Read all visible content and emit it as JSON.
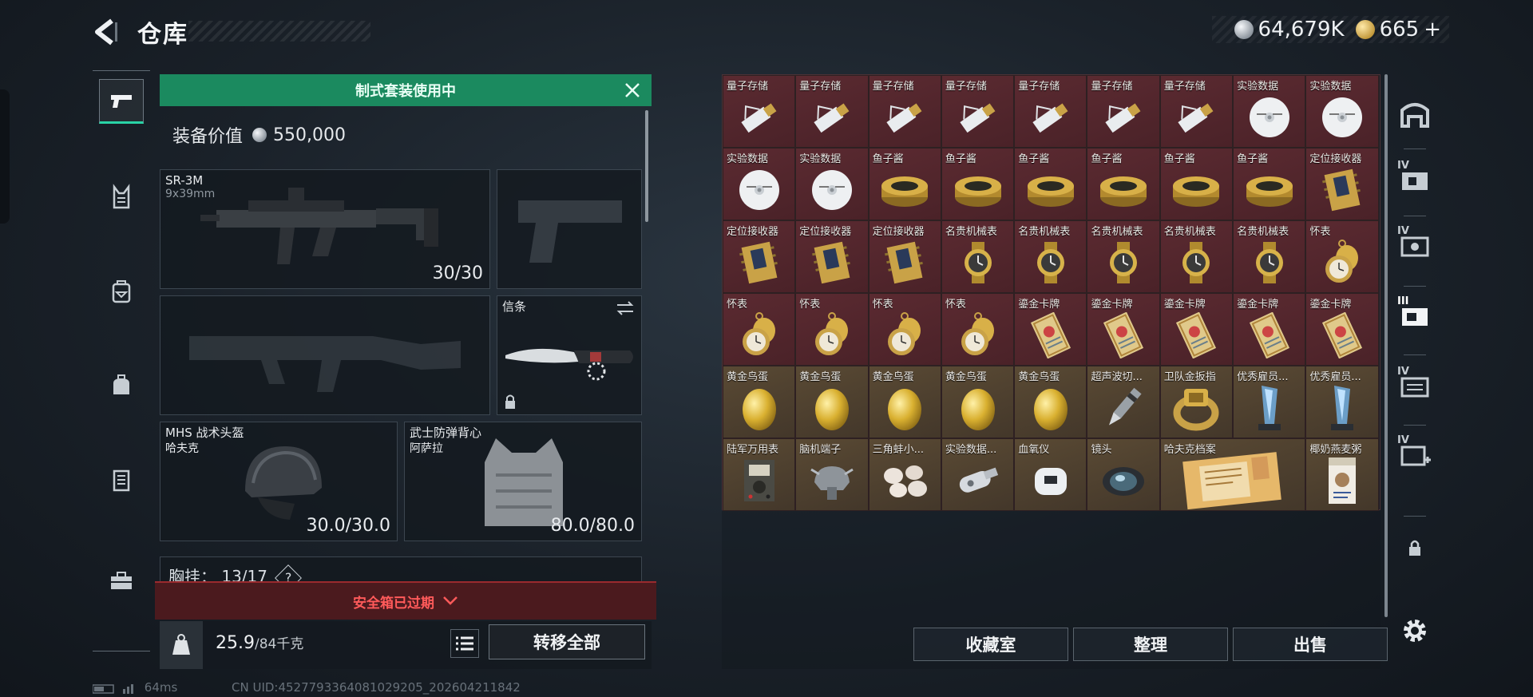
{
  "header": {
    "title": "仓库",
    "back_icon": "back-arrow-icon"
  },
  "currency": {
    "silver": "64,679K",
    "gold": "665",
    "gold_add": "+"
  },
  "tabs": [
    {
      "icon": "pistol-icon",
      "active": true
    },
    {
      "icon": "armor-icon"
    },
    {
      "icon": "backpack-icon"
    },
    {
      "icon": "bag-icon"
    },
    {
      "icon": "case-icon"
    },
    {
      "icon": "toolbox-icon"
    }
  ],
  "loadout": {
    "banner": "制式套装使用中",
    "value_label": "装备价值",
    "value": "550,000",
    "primary": {
      "name": "SR-3M",
      "caliber": "9x39mm",
      "ammo": "30/30"
    },
    "knife": {
      "name": "信条"
    },
    "helmet": {
      "name": "MHS 战术头盔",
      "sub": "哈夫克",
      "durability": "30.0/30.0"
    },
    "vest": {
      "name": "武士防弹背心",
      "sub": "阿萨拉",
      "durability": "80.0/80.0"
    },
    "chest_label": "胸挂：",
    "chest_value": "13/17",
    "chest_help": "?",
    "safe_expired": "安全箱已过期",
    "weight": "25.9",
    "weight_max": "/84千克",
    "transfer_all": "转移全部"
  },
  "storage": {
    "items": [
      {
        "label": "量子存储",
        "icon": "usb-drive-icon",
        "bg": "red"
      },
      {
        "label": "量子存储",
        "icon": "usb-drive-icon",
        "bg": "red"
      },
      {
        "label": "量子存储",
        "icon": "usb-drive-icon",
        "bg": "red"
      },
      {
        "label": "量子存储",
        "icon": "usb-drive-icon",
        "bg": "red"
      },
      {
        "label": "量子存储",
        "icon": "usb-drive-icon",
        "bg": "red"
      },
      {
        "label": "量子存储",
        "icon": "usb-drive-icon",
        "bg": "red"
      },
      {
        "label": "量子存储",
        "icon": "usb-drive-icon",
        "bg": "red"
      },
      {
        "label": "实验数据",
        "icon": "disc-icon",
        "bg": "red"
      },
      {
        "label": "实验数据",
        "icon": "disc-icon",
        "bg": "red"
      },
      {
        "label": "实验数据",
        "icon": "disc-icon",
        "bg": "red"
      },
      {
        "label": "实验数据",
        "icon": "disc-icon",
        "bg": "red"
      },
      {
        "label": "鱼子酱",
        "icon": "caviar-tin-icon",
        "bg": "red"
      },
      {
        "label": "鱼子酱",
        "icon": "caviar-tin-icon",
        "bg": "red"
      },
      {
        "label": "鱼子酱",
        "icon": "caviar-tin-icon",
        "bg": "red"
      },
      {
        "label": "鱼子酱",
        "icon": "caviar-tin-icon",
        "bg": "red"
      },
      {
        "label": "鱼子酱",
        "icon": "caviar-tin-icon",
        "bg": "red"
      },
      {
        "label": "鱼子酱",
        "icon": "caviar-tin-icon",
        "bg": "red"
      },
      {
        "label": "定位接收器",
        "icon": "gps-receiver-icon",
        "bg": "red"
      },
      {
        "label": "定位接收器",
        "icon": "gps-receiver-icon",
        "bg": "red"
      },
      {
        "label": "定位接收器",
        "icon": "gps-receiver-icon",
        "bg": "red"
      },
      {
        "label": "定位接收器",
        "icon": "gps-receiver-icon",
        "bg": "red"
      },
      {
        "label": "名贵机械表",
        "icon": "watch-icon",
        "bg": "red"
      },
      {
        "label": "名贵机械表",
        "icon": "watch-icon",
        "bg": "red"
      },
      {
        "label": "名贵机械表",
        "icon": "watch-icon",
        "bg": "red"
      },
      {
        "label": "名贵机械表",
        "icon": "watch-icon",
        "bg": "red"
      },
      {
        "label": "名贵机械表",
        "icon": "watch-icon",
        "bg": "red"
      },
      {
        "label": "怀表",
        "icon": "pocket-watch-icon",
        "bg": "red"
      },
      {
        "label": "怀表",
        "icon": "pocket-watch-icon",
        "bg": "red"
      },
      {
        "label": "怀表",
        "icon": "pocket-watch-icon",
        "bg": "red"
      },
      {
        "label": "怀表",
        "icon": "pocket-watch-icon",
        "bg": "red"
      },
      {
        "label": "怀表",
        "icon": "pocket-watch-icon",
        "bg": "red"
      },
      {
        "label": "鎏金卡牌",
        "icon": "gold-card-icon",
        "bg": "red"
      },
      {
        "label": "鎏金卡牌",
        "icon": "gold-card-icon",
        "bg": "red"
      },
      {
        "label": "鎏金卡牌",
        "icon": "gold-card-icon",
        "bg": "red"
      },
      {
        "label": "鎏金卡牌",
        "icon": "gold-card-icon",
        "bg": "red"
      },
      {
        "label": "鎏金卡牌",
        "icon": "gold-card-icon",
        "bg": "red"
      },
      {
        "label": "黄金鸟蛋",
        "icon": "golden-egg-icon",
        "bg": "gold"
      },
      {
        "label": "黄金鸟蛋",
        "icon": "golden-egg-icon",
        "bg": "gold"
      },
      {
        "label": "黄金鸟蛋",
        "icon": "golden-egg-icon",
        "bg": "gold"
      },
      {
        "label": "黄金鸟蛋",
        "icon": "golden-egg-icon",
        "bg": "gold"
      },
      {
        "label": "黄金鸟蛋",
        "icon": "golden-egg-icon",
        "bg": "gold"
      },
      {
        "label": "超声波切...",
        "icon": "ultrasonic-cutter-icon",
        "bg": "gold"
      },
      {
        "label": "卫队金扳指",
        "icon": "gold-ring-icon",
        "bg": "gold"
      },
      {
        "label": "优秀雇员...",
        "icon": "trophy-icon",
        "bg": "gold"
      },
      {
        "label": "优秀雇员...",
        "icon": "trophy-icon",
        "bg": "gold"
      },
      {
        "label": "陆军万用表",
        "icon": "multimeter-icon",
        "bg": "gold"
      },
      {
        "label": "脑机端子",
        "icon": "brain-terminal-icon",
        "bg": "gold"
      },
      {
        "label": "三角蚌小...",
        "icon": "pearls-icon",
        "bg": "gold"
      },
      {
        "label": "实验数据...",
        "icon": "whistle-icon",
        "bg": "gold"
      },
      {
        "label": "血氧仪",
        "icon": "oximeter-icon",
        "bg": "gold"
      },
      {
        "label": "镜头",
        "icon": "lens-icon",
        "bg": "gold"
      },
      {
        "label": "哈夫克档案",
        "icon": "files-icon",
        "bg": "gold",
        "wide": true
      },
      {
        "label": "椰奶燕麦粥",
        "icon": "oat-porridge-icon",
        "bg": "gold"
      }
    ]
  },
  "actions": {
    "collection": "收藏室",
    "organize": "整理",
    "sell": "出售"
  },
  "right_tabs": [
    {
      "icon": "home-storage-icon",
      "roman": ""
    },
    {
      "icon": "storage-IV-icon",
      "roman": "IV"
    },
    {
      "icon": "storage-IV-icon",
      "roman": "IV"
    },
    {
      "icon": "storage-III-icon",
      "roman": "III"
    },
    {
      "icon": "storage-IV-icon",
      "roman": "IV"
    },
    {
      "icon": "storage-IV-add-icon",
      "roman": "IV"
    },
    {
      "icon": "lock-icon",
      "roman": ""
    },
    {
      "icon": "settings-gear-icon",
      "roman": ""
    }
  ],
  "footer": {
    "ping": "64ms",
    "uid": "CN UID:4527793364081029205_202604211842"
  }
}
